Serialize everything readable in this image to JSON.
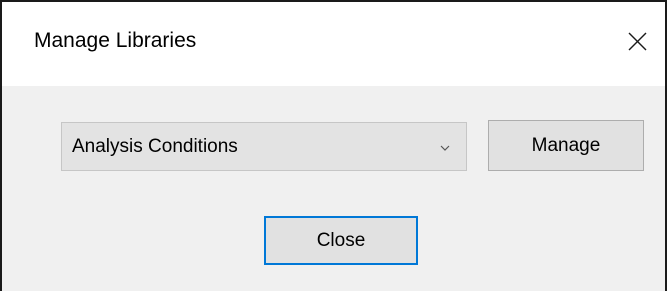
{
  "window": {
    "title": "Manage Libraries",
    "close_icon": "close-icon"
  },
  "library_select": {
    "selected_value": "Analysis Conditions",
    "arrow_icon": "chevron-down-icon"
  },
  "buttons": {
    "manage_label": "Manage",
    "close_label": "Close"
  },
  "colors": {
    "focus_border": "#0078d7",
    "dialog_background": "#f0f0f0"
  }
}
